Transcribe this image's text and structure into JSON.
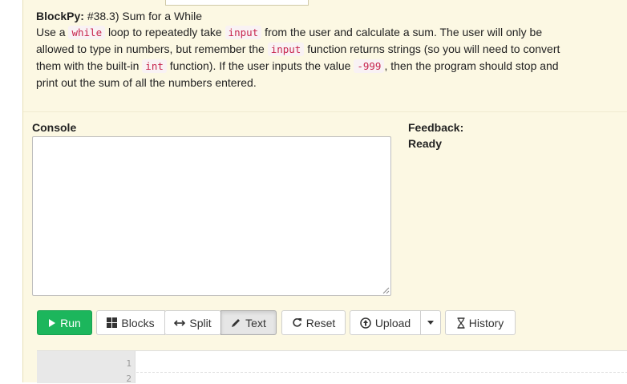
{
  "assignment": {
    "title_label": "BlockPy:",
    "title": "#38.3) Sum for a While",
    "text_1": "Use a ",
    "code_1": "while",
    "text_2": " loop to repeatedly take ",
    "code_2": "input",
    "text_3": " from the user and calculate a sum. The user will only be allowed to type in numbers, but remember the ",
    "code_3": "input",
    "text_4": " function returns strings (so you will need to convert them with the built-in ",
    "code_4": "int",
    "text_5": " function). If the user inputs the value ",
    "code_5": "-999",
    "text_6": ", then the program should stop and print out the sum of all the numbers entered."
  },
  "console": {
    "label": "Console",
    "value": ""
  },
  "feedback": {
    "label": "Feedback:",
    "status": "Ready"
  },
  "toolbar": {
    "run_label": "Run",
    "blocks_label": "Blocks",
    "split_label": "Split",
    "text_label": "Text",
    "reset_label": "Reset",
    "upload_label": "Upload",
    "history_label": "History",
    "active_mode": "Text"
  },
  "editor": {
    "line_numbers": [
      "1",
      "2"
    ]
  },
  "colors": {
    "panel": "#fcf8e3",
    "run": "#1cb65c",
    "code_text": "#c7254e",
    "code_bg": "#f9f2f4"
  },
  "icons": {
    "run": "play-icon",
    "blocks": "grid-icon",
    "split": "arrows-horizontal-icon",
    "text": "pencil-icon",
    "reset": "refresh-icon",
    "upload": "upload-circle-icon",
    "caret": "caret-down-icon",
    "history": "hourglass-icon"
  }
}
